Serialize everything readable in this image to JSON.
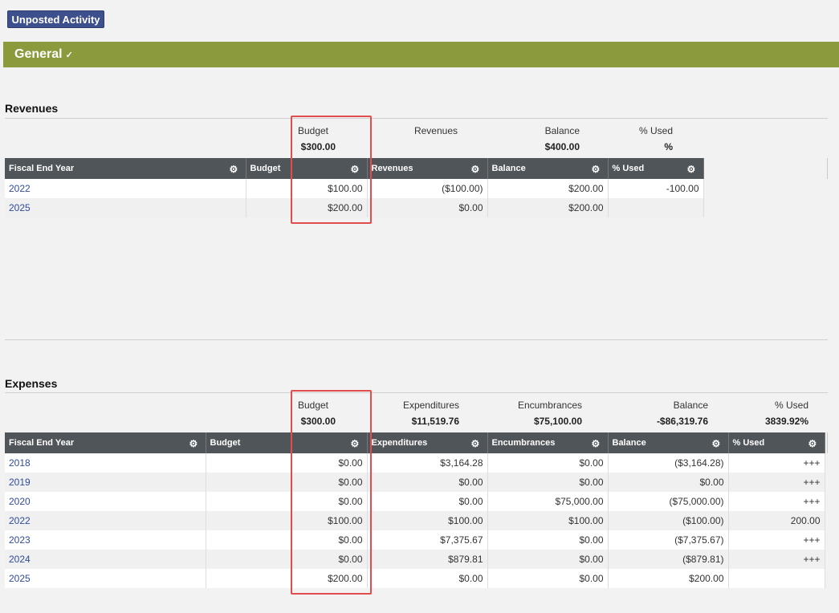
{
  "top_button": "Unposted Activity",
  "section": {
    "title": "General",
    "check": "✓"
  },
  "revenues": {
    "title": "Revenues",
    "summary": [
      {
        "label": "Budget",
        "value": "$300.00"
      },
      {
        "label": "Revenues",
        "value": ""
      },
      {
        "label": "Balance",
        "value": "$400.00"
      },
      {
        "label": "% Used",
        "value": "%"
      }
    ],
    "columns": [
      "Fiscal End Year",
      "Budget",
      "",
      "Revenues",
      "Balance",
      "% Used"
    ],
    "rows": [
      [
        "2022",
        "",
        "$100.00",
        "($100.00)",
        "$200.00",
        "-100.00"
      ],
      [
        "2025",
        "",
        "$200.00",
        "$0.00",
        "$200.00",
        ""
      ]
    ]
  },
  "expenses": {
    "title": "Expenses",
    "summary": [
      {
        "label": "Budget",
        "value": "$300.00"
      },
      {
        "label": "Expenditures",
        "value": "$11,519.76"
      },
      {
        "label": "Encumbrances",
        "value": "$75,100.00"
      },
      {
        "label": "Balance",
        "value": "-$86,319.76"
      },
      {
        "label": "% Used",
        "value": "3839.92%"
      }
    ],
    "columns": [
      "Fiscal End Year",
      "Budget",
      "",
      "Expenditures",
      "Encumbrances",
      "Balance",
      "% Used"
    ],
    "rows": [
      [
        "2018",
        "",
        "$0.00",
        "$3,164.28",
        "$0.00",
        "($3,164.28)",
        "+++"
      ],
      [
        "2019",
        "",
        "$0.00",
        "$0.00",
        "$0.00",
        "$0.00",
        "+++"
      ],
      [
        "2020",
        "",
        "$0.00",
        "$0.00",
        "$75,000.00",
        "($75,000.00)",
        "+++"
      ],
      [
        "2022",
        "",
        "$100.00",
        "$100.00",
        "$100.00",
        "($100.00)",
        "200.00"
      ],
      [
        "2023",
        "",
        "$0.00",
        "$7,375.67",
        "$0.00",
        "($7,375.67)",
        "+++"
      ],
      [
        "2024",
        "",
        "$0.00",
        "$879.81",
        "$0.00",
        "($879.81)",
        "+++"
      ],
      [
        "2025",
        "",
        "$200.00",
        "$0.00",
        "$0.00",
        "$200.00",
        ""
      ]
    ]
  },
  "icons": {
    "gear": "gear-icon",
    "check": "check-icon"
  },
  "colors": {
    "header_bar": "#8a9a3d",
    "button": "#3d4f8c",
    "grid_header": "#4f5559",
    "highlight": "#e14c4c",
    "link": "#2f4b9a"
  }
}
